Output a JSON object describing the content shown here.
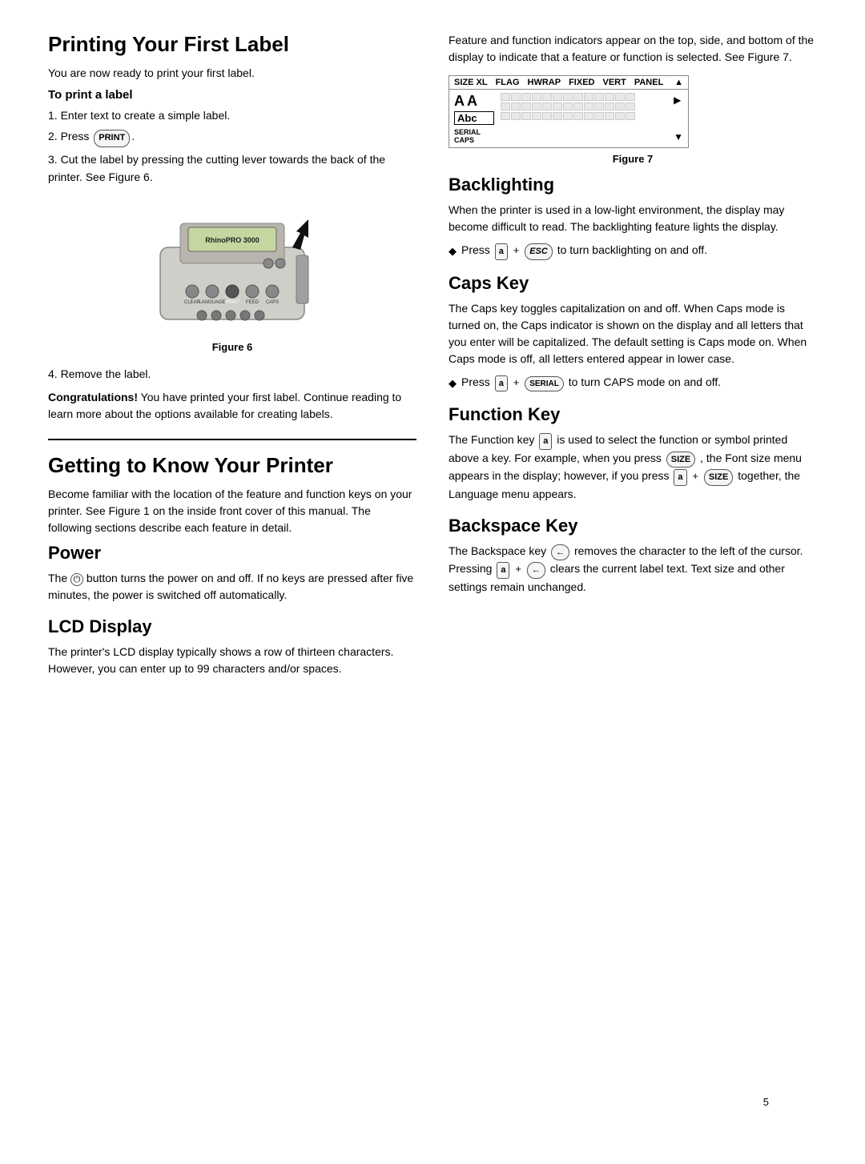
{
  "page": {
    "number": "5"
  },
  "left": {
    "section1": {
      "title": "Printing Your First Label",
      "intro": "You are now ready to print your first label.",
      "subheading": "To print a label",
      "steps": [
        "Enter text to create a simple label.",
        "Press",
        "Cut the label by pressing the cutting lever towards the back of the printer. See Figure 6.",
        "Remove the label."
      ],
      "print_key_label": "PRINT",
      "figure6_label": "Figure 6",
      "congrats_text": "Congratulations!",
      "congrats_rest": " You have printed your first label. Continue reading to learn more about the options available for creating labels."
    },
    "section2": {
      "title": "Getting to Know Your Printer",
      "intro": "Become familiar with the location of the feature and function keys on your printer. See Figure 1 on the inside front cover of this manual. The following sections describe each feature in detail.",
      "power": {
        "title": "Power",
        "text": "The   button turns the power on and off. If no keys are pressed after five minutes, the power is switched off automatically."
      },
      "lcd": {
        "title": "LCD Display",
        "text": "The printer's LCD display typically shows a row of thirteen characters. However, you can enter up to 99 characters and/or spaces."
      }
    }
  },
  "right": {
    "display_figure": {
      "headers": [
        "SIZE XL",
        "FLAG",
        "HWRAP",
        "FIXED",
        "VERT",
        "PANEL"
      ],
      "aa_text": "AA",
      "abc_text": "Abc",
      "serial_text": "SERIAL",
      "caps_text": "CAPS",
      "figure_label": "Figure 7",
      "intro": "Feature and function indicators appear on the top, side, and bottom of the display to indicate that a feature or function is selected. See Figure 7."
    },
    "backlighting": {
      "title": "Backlighting",
      "text": "When the printer is used in a low-light environment, the display may become difficult to read. The backlighting feature lights the display.",
      "bullet": "Press",
      "fn_key": "a",
      "esc_key": "ESC",
      "bullet_rest": "to turn backlighting on and off."
    },
    "caps_key": {
      "title": "Caps Key",
      "text": "The Caps key toggles capitalization on and off. When Caps mode is turned on, the Caps indicator is shown on the display and all letters that you enter will be capitalized. The default setting is Caps mode on. When Caps mode is off, all letters entered appear in lower case.",
      "bullet": "Press",
      "fn_key": "a",
      "serial_key": "SERIAL",
      "bullet_rest": "to turn CAPS mode on and off."
    },
    "function_key": {
      "title": "Function Key",
      "text_1": "The Function key",
      "fn_key": "a",
      "text_2": "is used to select the function or symbol printed above a key. For example, when you press",
      "size_key": "SIZE",
      "text_3": ", the Font size menu appears in the display; however, if you press",
      "fn_key2": "a",
      "size_key2": "SIZE",
      "text_4": "together, the Language menu appears."
    },
    "backspace_key": {
      "title": "Backspace Key",
      "text_1": "The Backspace key",
      "back_key": "←",
      "text_2": "removes the character to the left of the cursor. Pressing",
      "fn_key": "a",
      "back_key2": "←",
      "text_3": "clears the current label text. Text size and other settings remain unchanged."
    }
  }
}
